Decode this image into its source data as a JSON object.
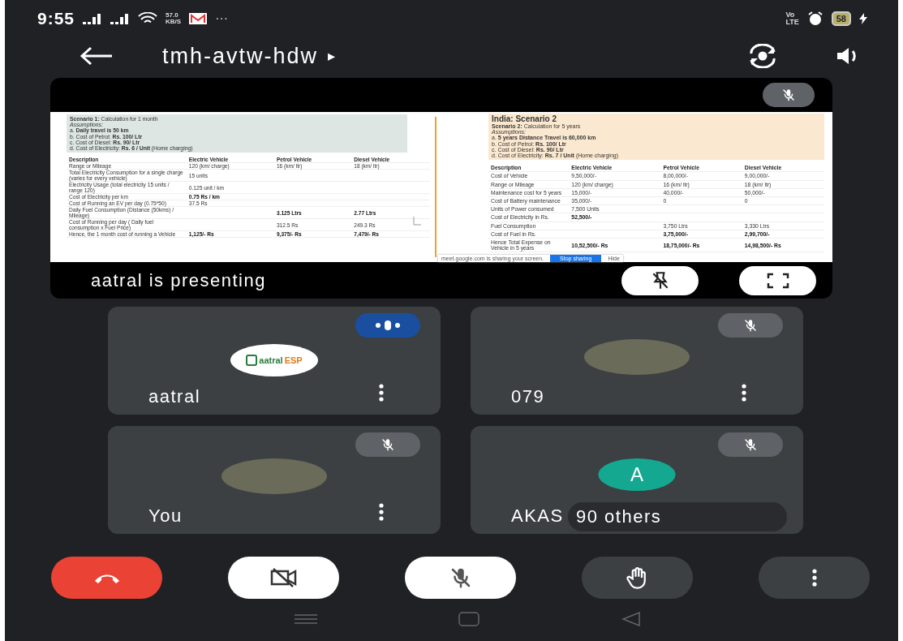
{
  "status_bar": {
    "time": "9:55",
    "speed_value": "57.0",
    "speed_unit": "KB/S",
    "more": "···",
    "volte_top": "Vo",
    "volte_bottom": "LTE",
    "battery": "58"
  },
  "header": {
    "title": "tmh-avtw-hdw",
    "title_caret": "▸"
  },
  "presentation": {
    "muted": true,
    "presenter_label": "aatral is presenting",
    "slide": {
      "left": {
        "intro": "**Scenario 1:** Calculation for 1 month",
        "assumptions_label": "Assumptions:",
        "assumptions": [
          "a. **Daily travel is 50 km**",
          "b. Cost of Petrol: **Rs. 100/ Ltr**",
          "c. Cost of Diesel: **Rs. 90/ Ltr**",
          "d. Cost of Electricity: **Rs. 6 / Unit** (Home charging)"
        ],
        "columns": [
          "Description",
          "Electric Vehicle",
          "Petrol Vehicle",
          "Diesel Vehicle"
        ],
        "rows": [
          {
            "bold": false,
            "description": "Range or Mileage",
            "electric": "120 (km/ charge)",
            "petrol": "16 (km/ ltr)",
            "diesel": "18 (km/ ltr)"
          },
          {
            "bold": false,
            "description": "Total Electricity Consumption for a single charge (varies for every vehicle)",
            "electric": "15 units"
          },
          {
            "bold": false,
            "description": "Electricity Usage (total electricity 15 units / range 120)",
            "electric": "0.125 unit / km"
          },
          {
            "bold": true,
            "description": "Cost of Electricity per km",
            "electric": "0.75 Rs / km"
          },
          {
            "bold": false,
            "description": "Cost of Running an EV per day (0.75*50)",
            "electric": "37.5 Rs"
          },
          {
            "bold": true,
            "description": "Daily Fuel Consumption (Distance (50kms) / Mileage)",
            "petrol": "3.125 Ltrs",
            "diesel": "2.77 Ltrs"
          },
          {
            "bold": false,
            "description": "Cost of Running per day ( Daily fuel consumption x Fuel Price)",
            "petrol": "312.5 Rs",
            "diesel": "249.3 Rs"
          },
          {
            "bold": true,
            "description": "Hence, the 1 month cost of running a Vehicle",
            "electric": "1,125/- Rs",
            "petrol": "9,375/- Rs",
            "diesel": "7,479/- Rs"
          }
        ]
      },
      "right": {
        "heading": "India: Scenario 2",
        "intro": "**Scenario 2:** Calculation for 5 years",
        "assumptions_label": "Assumptions:",
        "assumptions": [
          "a. **5 years Distance Travel is 60,000 km**",
          "b. Cost of Petrol: **Rs. 100/ Ltr**",
          "c. Cost of Diesel: **Rs. 90/ Ltr**",
          "d. Cost of Electricity: **Rs. 7 / Unit** (Home charging)"
        ],
        "columns": [
          "Description",
          "Electric Vehicle",
          "Petrol Vehicle",
          "Diesel Vehicle"
        ],
        "rows": [
          {
            "bold": false,
            "description": "Cost of Vehicle",
            "electric": "9,50,000/-",
            "petrol": "8,00,000/-",
            "diesel": "9,00,000/-"
          },
          {
            "bold": false,
            "description": "Range or Mileage",
            "electric": "120 (km/ charge)",
            "petrol": "16 (km/ ltr)",
            "diesel": "18 (km/ ltr)"
          },
          {
            "bold": false,
            "description": "Maintenance cost for 5 years",
            "electric": "15,000/-",
            "petrol": "40,000/-",
            "diesel": "50,000/-"
          },
          {
            "bold": false,
            "description": "Cost of Battery maintenance",
            "electric": "35,000/-",
            "petrol": "0",
            "diesel": "0"
          },
          {
            "bold": false,
            "description": "Units of Power consumed",
            "electric": "7,500 Units"
          },
          {
            "bold": true,
            "description": "Cost of Electricity in Rs.",
            "electric": "52,500/-"
          },
          {
            "bold": false,
            "description": "Fuel Consumption",
            "petrol": "3,750 Ltrs",
            "diesel": "3,330 Ltrs"
          },
          {
            "bold": true,
            "description": "Cost of Fuel in Rs.",
            "petrol": "3,75,000/-",
            "diesel": "2,99,700/-"
          },
          {
            "bold": true,
            "description": "Hence Total Expense on Vehicle in 5 years",
            "electric": "10,52,500/- Rs",
            "petrol": "18,75,000/- Rs",
            "diesel": "14,98,500/- Rs"
          }
        ]
      },
      "share_bar": {
        "message": "meet.google.com is sharing your screen.",
        "stop": "Stop sharing",
        "hide": "Hide"
      }
    }
  },
  "tiles": [
    {
      "name": "aatral",
      "muted": false,
      "speaking": true,
      "avatar": {
        "kind": "logo",
        "logo_name": "aatral",
        "logo_suffix": "ESP"
      }
    },
    {
      "name": "079",
      "muted": true,
      "speaking": false,
      "avatar": {
        "kind": "photo"
      }
    },
    {
      "name": "You",
      "muted": true,
      "speaking": false,
      "avatar": {
        "kind": "photo"
      }
    },
    {
      "name": "AKAS",
      "muted": true,
      "speaking": false,
      "avatar": {
        "kind": "letter",
        "letter": "A"
      },
      "overlay": "90 others"
    }
  ],
  "controls": [
    {
      "kind": "end_call"
    },
    {
      "kind": "camera",
      "on": false
    },
    {
      "kind": "mic",
      "on": false
    },
    {
      "kind": "hand"
    },
    {
      "kind": "more"
    }
  ]
}
